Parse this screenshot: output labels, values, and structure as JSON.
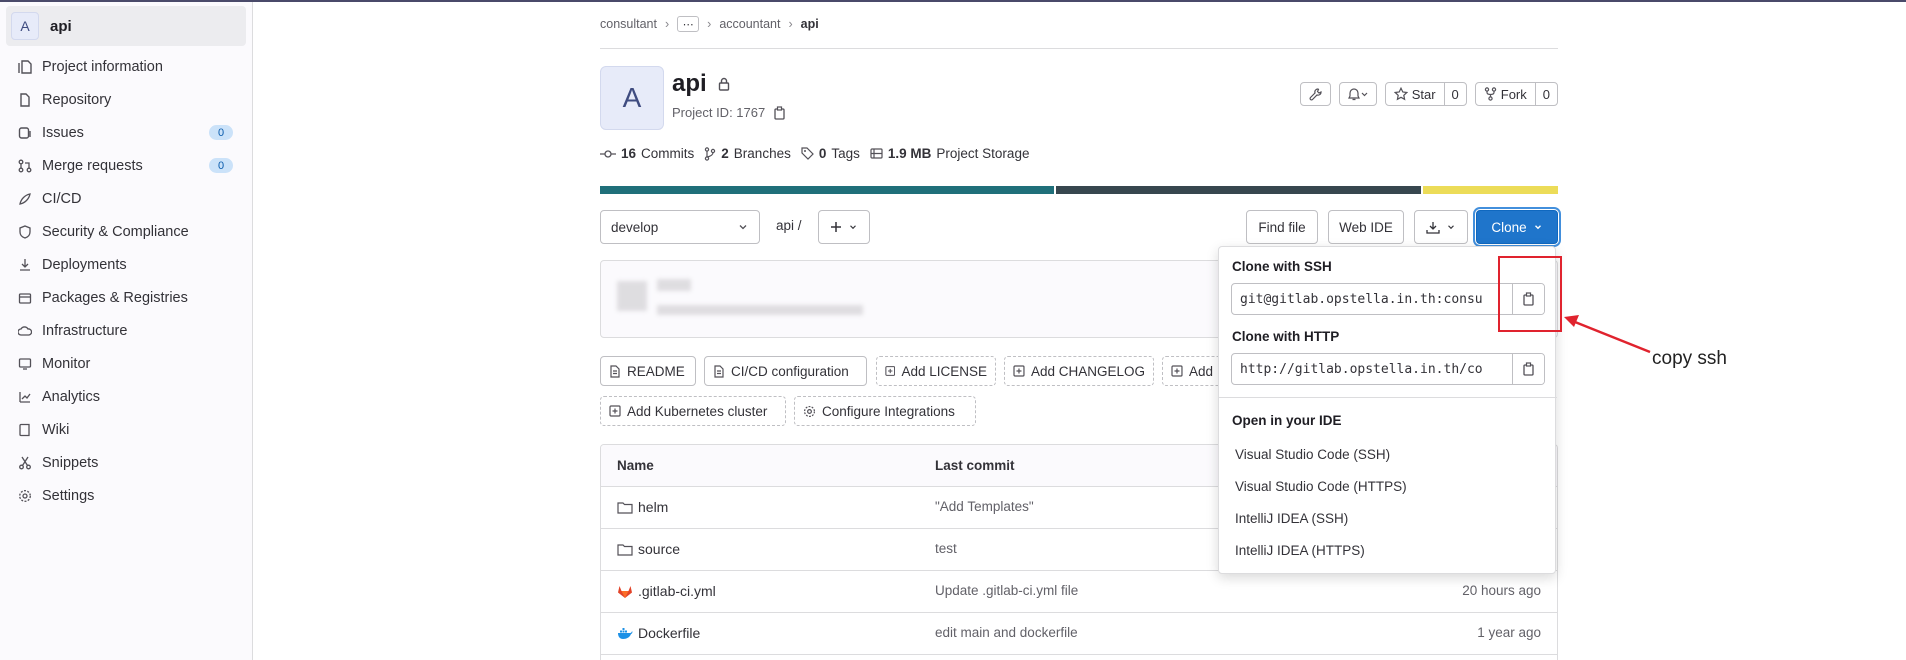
{
  "sidebar": {
    "project_initial": "A",
    "project_name": "api",
    "items": [
      {
        "label": "Project information",
        "icon": "project-icon"
      },
      {
        "label": "Repository",
        "icon": "doc-icon"
      },
      {
        "label": "Issues",
        "icon": "issues-icon",
        "badge": "0"
      },
      {
        "label": "Merge requests",
        "icon": "merge-request-icon",
        "badge": "0"
      },
      {
        "label": "CI/CD",
        "icon": "rocket-icon"
      },
      {
        "label": "Security & Compliance",
        "icon": "shield-icon"
      },
      {
        "label": "Deployments",
        "icon": "deployments-icon"
      },
      {
        "label": "Packages & Registries",
        "icon": "package-icon"
      },
      {
        "label": "Infrastructure",
        "icon": "cloud-icon"
      },
      {
        "label": "Monitor",
        "icon": "monitor-icon"
      },
      {
        "label": "Analytics",
        "icon": "chart-icon"
      },
      {
        "label": "Wiki",
        "icon": "book-icon"
      },
      {
        "label": "Snippets",
        "icon": "snippet-icon"
      },
      {
        "label": "Settings",
        "icon": "gear-icon"
      }
    ]
  },
  "breadcrumb": {
    "items": [
      "consultant",
      "accountant",
      "api"
    ],
    "more": "⋯"
  },
  "project": {
    "initial": "A",
    "title": "api",
    "project_id": "Project ID: 1767",
    "star_label": "Star",
    "star_count": "0",
    "fork_label": "Fork",
    "fork_count": "0"
  },
  "stats": {
    "commits_count": "16",
    "commits_label": "Commits",
    "branches_count": "2",
    "branches_label": "Branches",
    "tags_count": "0",
    "tags_label": "Tags",
    "storage_size": "1.9 MB",
    "storage_label": "Project Storage"
  },
  "language_bar": [
    {
      "color": "#1f6f7a",
      "share": 0.476
    },
    {
      "color": "#37474f",
      "share": 0.383
    },
    {
      "color": "#ecdc58",
      "share": 0.141
    }
  ],
  "controls": {
    "branch": "develop",
    "path": "api  /",
    "find_file": "Find file",
    "web_ide": "Web IDE",
    "clone": "Clone"
  },
  "shortcuts": {
    "readme": "README",
    "cicd_config": "CI/CD configuration",
    "add_license": "Add LICENSE",
    "add_changelog": "Add CHANGELOG",
    "add_partial": "Add",
    "add_k8s": "Add Kubernetes cluster",
    "configure_integrations": "Configure Integrations"
  },
  "table": {
    "headers": {
      "name": "Name",
      "last_commit": "Last commit"
    },
    "rows": [
      {
        "name": "helm",
        "icon": "folder-icon",
        "message": "\"Add Templates\"",
        "when": ""
      },
      {
        "name": "source",
        "icon": "folder-icon",
        "message": "test",
        "when": ""
      },
      {
        "name": ".gitlab-ci.yml",
        "icon": "gitlab-icon",
        "message": "Update .gitlab-ci.yml file",
        "when": "20 hours ago"
      },
      {
        "name": "Dockerfile",
        "icon": "docker-icon",
        "message": "edit main and dockerfile",
        "when": "1 year ago"
      }
    ]
  },
  "clone_dropdown": {
    "ssh_heading": "Clone with SSH",
    "ssh_url": "git@gitlab.opstella.in.th:consu",
    "http_heading": "Clone with HTTP",
    "http_url": "http://gitlab.opstella.in.th/co",
    "ide_heading": "Open in your IDE",
    "ide_items": [
      "Visual Studio Code (SSH)",
      "Visual Studio Code (HTTPS)",
      "IntelliJ IDEA (SSH)",
      "IntelliJ IDEA (HTTPS)"
    ]
  },
  "annotation": {
    "label": "copy ssh",
    "color": "#e0232e"
  }
}
